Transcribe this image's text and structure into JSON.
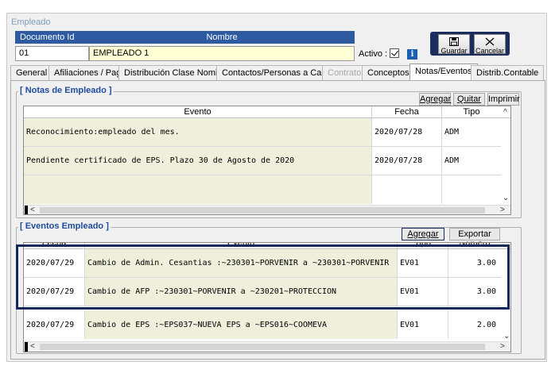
{
  "window": {
    "title": "Empleado"
  },
  "header": {
    "col_doc_label": "Documento Id",
    "col_name_label": "Nombre",
    "doc_value": "01",
    "name_value": "EMPLEADO 1",
    "active_label": "Activo :",
    "active_checked": true
  },
  "toolbar": {
    "save_label": "Guardar",
    "cancel_label": "Cancelar"
  },
  "tabs": [
    {
      "label": "General",
      "state": "normal"
    },
    {
      "label": "Afiliaciones / Pago",
      "state": "normal"
    },
    {
      "label": "Distribución Clase Nomina",
      "state": "normal"
    },
    {
      "label": "Contactos/Personas a Cargo",
      "state": "normal"
    },
    {
      "label": "Contratos",
      "state": "disabled"
    },
    {
      "label": "Conceptos",
      "state": "normal"
    },
    {
      "label": "Notas/Eventos",
      "state": "active"
    },
    {
      "label": "Distrib.Contable",
      "state": "normal"
    }
  ],
  "notes": {
    "group_title": "[ Notas de Empleado ]",
    "add_label": "Agregar",
    "remove_label": "Quitar",
    "print_label": "Imprimir",
    "columns": [
      "Evento",
      "Fecha",
      "Tipo"
    ],
    "rows": [
      {
        "evento": "Reconocimiento:empleado del mes.",
        "fecha": "2020/07/28",
        "tipo": "ADM"
      },
      {
        "evento": "Pendiente certificado de EPS. Plazo 30 de Agosto de 2020",
        "fecha": "2020/07/28",
        "tipo": "ADM"
      },
      {
        "evento": "",
        "fecha": "",
        "tipo": ""
      }
    ]
  },
  "events": {
    "group_title": "[ Eventos Empleado ]",
    "add_label": "Agregar",
    "export_label": "Exportar XLS",
    "columns": [
      "Fecha",
      "Evento",
      "Tipo",
      "Numero"
    ],
    "rows": [
      {
        "fecha": "2020/07/29",
        "evento": "Cambio de Admin. Cesantias :~230301~PORVENIR a ~230301~PORVENIR",
        "tipo": "EV01",
        "numero": "3.00"
      },
      {
        "fecha": "2020/07/29",
        "evento": "Cambio de AFP :~230301~PORVENIR a ~230201~PROTECCION",
        "tipo": "EV01",
        "numero": "3.00"
      },
      {
        "fecha": "2020/07/29",
        "evento": "Cambio de EPS :~EPS037~NUEVA EPS a ~EPS016~COOMEVA",
        "tipo": "EV01",
        "numero": "2.00"
      }
    ]
  }
}
